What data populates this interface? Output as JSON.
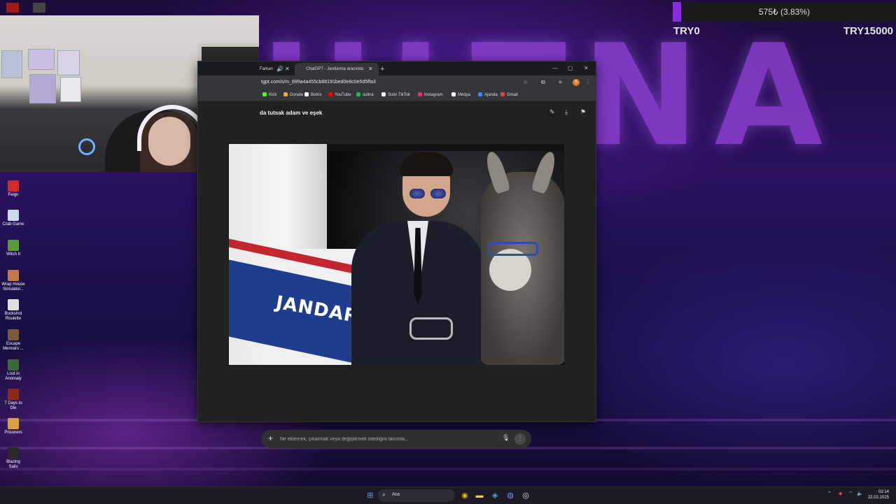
{
  "donation_goal": {
    "current_text": "575₺ (3.83%)",
    "progress_percent": 3.83,
    "min_label": "TRY0",
    "max_label": "TRY15000",
    "fill_color": "#8a2be2"
  },
  "overlay": {
    "background_text": "ULTNA"
  },
  "desktop_icons": [
    {
      "label": "Feign",
      "icon": "feign-icon",
      "color": "#d42a2a"
    },
    {
      "label": "Crab Game",
      "icon": "crab-game-icon",
      "color": "#cfd8e8"
    },
    {
      "label": "Witch It",
      "icon": "witch-it-icon",
      "color": "#5a9a3a"
    },
    {
      "label": "Wrap House Simulator...",
      "icon": "wrap-house-icon",
      "color": "#c07a4a"
    },
    {
      "label": "Buckshot Roulette",
      "icon": "buckshot-roulette-icon",
      "color": "#e0e0e0"
    },
    {
      "label": "Escape Memoirs ...",
      "icon": "escape-memoirs-icon",
      "color": "#7a5a3a"
    },
    {
      "label": "Lost in Anomaly",
      "icon": "lost-in-anomaly-icon",
      "color": "#3a6a3a"
    },
    {
      "label": "7 Days to Die",
      "icon": "seven-days-icon",
      "color": "#8a2a1a"
    },
    {
      "label": "Prisoners",
      "icon": "prisoners-icon",
      "color": "#d8a040"
    },
    {
      "label": "Blazing Sails",
      "icon": "blazing-sails-icon",
      "color": "#2a2a2a"
    }
  ],
  "browser": {
    "tabs": [
      {
        "label": "Farkan",
        "active": false
      },
      {
        "label": "ChatGPT - Jandarma aracında",
        "active": true
      }
    ],
    "url": "tgpt.com/s/m_699a4a455cb88191bed0e8c0e5d5ffa3",
    "profile_initial": "S",
    "bookmarks": [
      {
        "label": "Kick",
        "color": "#53fc18"
      },
      {
        "label": "Donate",
        "color": "#f2a33a"
      },
      {
        "label": "Botrix",
        "color": "#ffffff"
      },
      {
        "label": "YouTube",
        "color": "#ff0000"
      },
      {
        "label": "sulina",
        "color": "#1db954"
      },
      {
        "label": "Sulin TikTok",
        "color": "#ffffff"
      },
      {
        "label": "Instagram",
        "color": "#e1306c"
      },
      {
        "label": "Medya",
        "color": "#ffffff"
      },
      {
        "label": "Ajanda",
        "color": "#4285f4"
      },
      {
        "label": "Gmail",
        "color": "#ea4335"
      }
    ],
    "chat_title": "da tutsak adam ve eşek",
    "image": {
      "car_text": "JANDARMA"
    },
    "prompt": {
      "placeholder": "Ne eklemek, çıkarmak veya değiştirmek istediğini tanımla..."
    }
  },
  "taskbar": {
    "search_label": "Ara",
    "clock_time": "03:14",
    "clock_date": "22.02.2025"
  }
}
